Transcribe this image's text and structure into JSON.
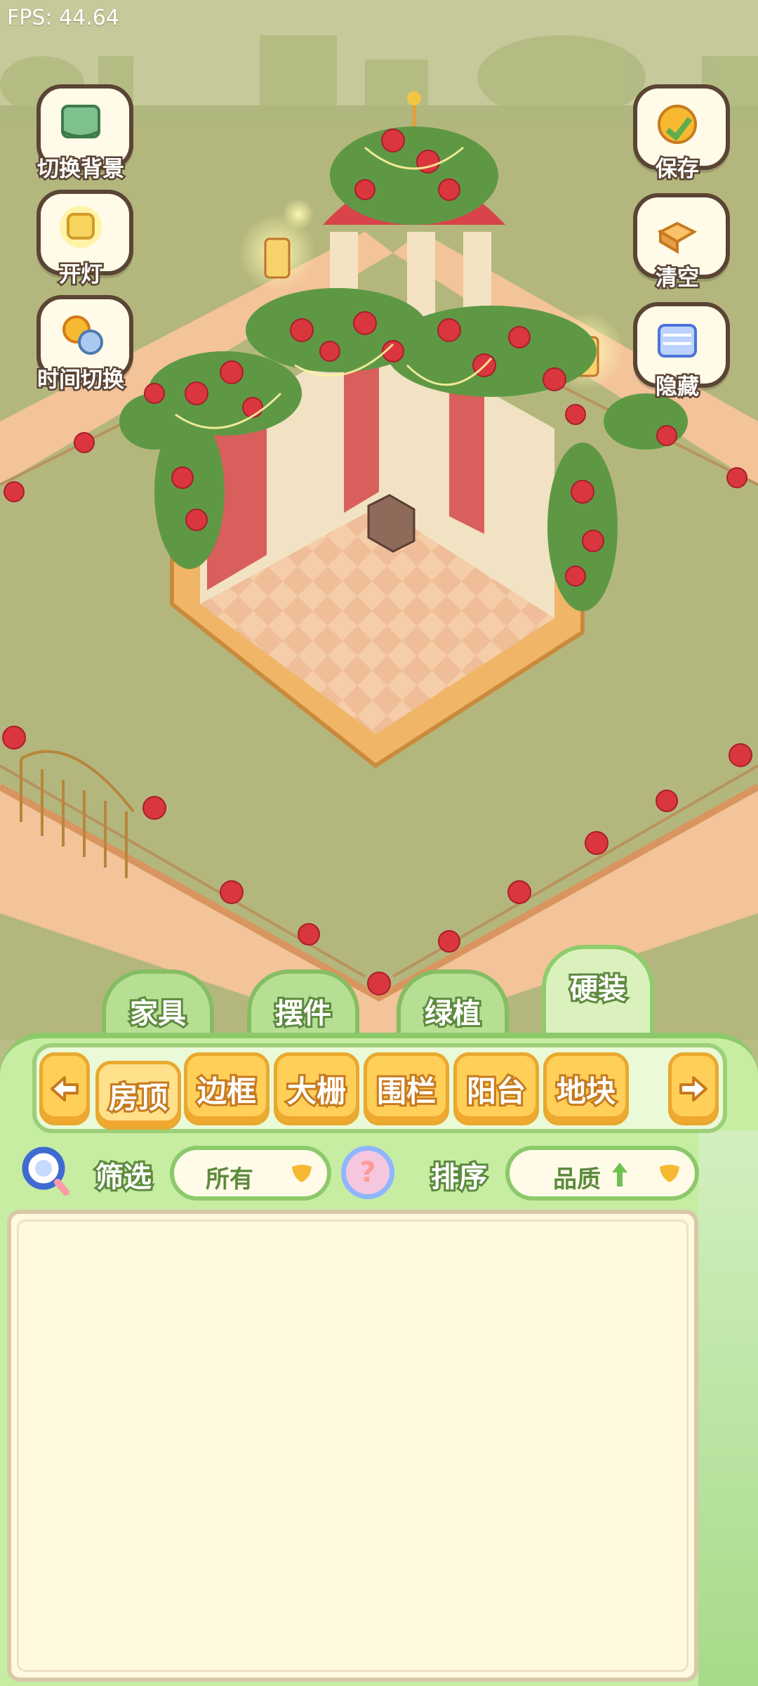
{
  "fps": "FPS: 44.64",
  "left_buttons": [
    {
      "label": "切换背景",
      "icon": "scroll-map-icon"
    },
    {
      "label": "开灯",
      "icon": "lamp-icon"
    },
    {
      "label": "时间切换",
      "icon": "sun-moon-icon"
    }
  ],
  "right_buttons": [
    {
      "label": "保存",
      "icon": "save-chick-icon"
    },
    {
      "label": "清空",
      "icon": "clear-box-icon"
    },
    {
      "label": "隐藏",
      "icon": "hide-icon"
    }
  ],
  "category_tabs": [
    {
      "label": "家具",
      "active": false
    },
    {
      "label": "摆件",
      "active": false
    },
    {
      "label": "绿植",
      "active": false
    },
    {
      "label": "硬装",
      "active": true
    }
  ],
  "sub_tabs": [
    {
      "label": "房顶",
      "active": true
    },
    {
      "label": "边框",
      "active": false
    },
    {
      "label": "大栅",
      "active": false
    },
    {
      "label": "围栏",
      "active": false
    },
    {
      "label": "阳台",
      "active": false
    },
    {
      "label": "地块",
      "active": false
    }
  ],
  "filter": {
    "label": "筛选",
    "value": "所有"
  },
  "help_glyph": "?",
  "sort": {
    "label": "排序",
    "value": "品质",
    "direction_icon": "arrow-up-icon"
  },
  "colors": {
    "accent_green": "#8cc96a",
    "tab_orange": "#ffcf58",
    "rose_red": "#d9363e"
  }
}
